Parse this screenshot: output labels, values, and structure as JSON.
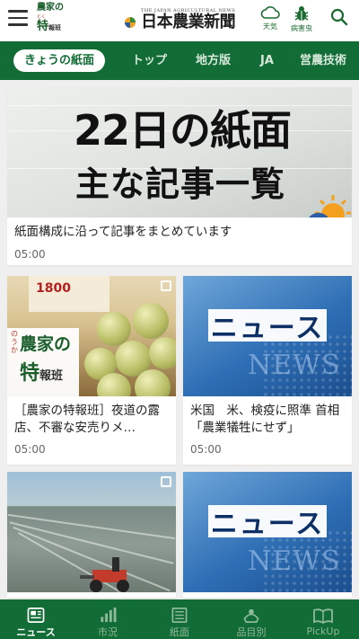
{
  "header": {
    "tokuho_logo": {
      "line1": "農家の",
      "line2": "とく",
      "line3": "特",
      "line3_small": "報班"
    },
    "brand_sub": "THE JAPAN AGRICULTURAL NEWS",
    "brand_name": "日本農業新聞",
    "weather_label": "天気",
    "pest_label": "病害虫",
    "icons": [
      "menu-icon",
      "cloud-icon",
      "bug-icon",
      "search-icon"
    ]
  },
  "tabs": [
    {
      "label": "きょうの紙面",
      "active": true
    },
    {
      "label": "トップ",
      "active": false
    },
    {
      "label": "地方版",
      "active": false
    },
    {
      "label": "JA",
      "active": false
    },
    {
      "label": "営農技術",
      "active": false
    }
  ],
  "hero": {
    "image_line1": "22日の紙面",
    "image_line2": "主な記事一覧",
    "title": "紙面構成に沿って記事をまとめています",
    "time": "05:00"
  },
  "cards": [
    {
      "thumb": "market",
      "sign_text": "1800",
      "badge": {
        "a": "のうか",
        "b": "農家の",
        "c": "特",
        "c_small": "報班"
      },
      "title": "［農家の特報班］夜道の露店、不審な安売りメ…",
      "time": "05:00"
    },
    {
      "thumb": "news",
      "box_text": "ニュース",
      "ghost_text": "NEWS",
      "title": "米国　米、検疫に照準 首相「農業犠牲にせず」",
      "time": "05:00"
    },
    {
      "thumb": "field"
    },
    {
      "thumb": "news",
      "box_text": "ニュース",
      "ghost_text": "NEWS"
    }
  ],
  "bottom_nav": [
    {
      "label": "ニュース",
      "icon": "newspaper-icon",
      "active": true
    },
    {
      "label": "市況",
      "icon": "bar-chart-icon",
      "active": false
    },
    {
      "label": "紙面",
      "icon": "paper-icon",
      "active": false
    },
    {
      "label": "品目別",
      "icon": "produce-icon",
      "active": false
    },
    {
      "label": "PickUp",
      "icon": "book-icon",
      "active": false
    }
  ],
  "colors": {
    "primary": "#116c35",
    "background": "#efefef",
    "news_blue": "#2f6fb5"
  }
}
